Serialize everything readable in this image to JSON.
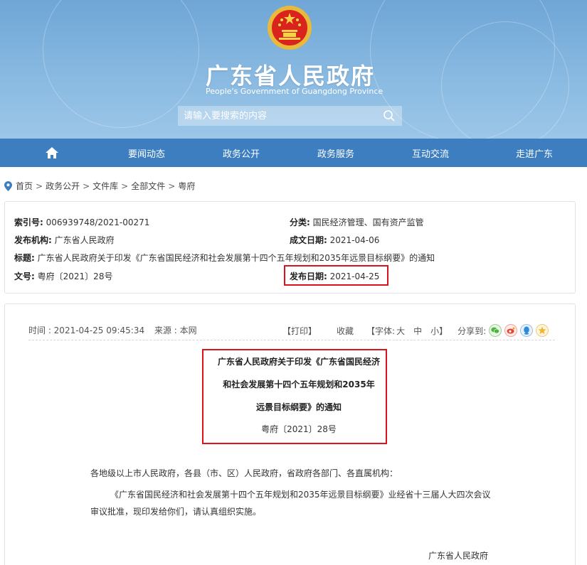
{
  "header": {
    "title": "广东省人民政府",
    "subtitle": "People's Government of Guangdong Province",
    "search_placeholder": "请输入要搜索的内容"
  },
  "nav": {
    "items": [
      "要闻动态",
      "政务公开",
      "政务服务",
      "互动交流",
      "走进广东"
    ]
  },
  "breadcrumb": [
    "首页",
    "政务公开",
    "文件库",
    "全部文件",
    "粤府"
  ],
  "info": {
    "index_label": "索引号:",
    "index_value": "006939748/2021-00271",
    "category_label": "分类:",
    "category_value": "国民经济管理、国有资产监管",
    "issuer_label": "发布机构:",
    "issuer_value": "广东省人民政府",
    "written_label": "成文日期:",
    "written_value": "2021-04-06",
    "title_label": "标题:",
    "title_value": "广东省人民政府关于印发《广东省国民经济和社会发展第十四个五年规划和2035年远景目标纲要》的通知",
    "docno_label": "文号:",
    "docno_value": "粤府〔2021〕28号",
    "pubdate_label": "发布日期:",
    "pubdate_value": "2021-04-25"
  },
  "article": {
    "meta_time": "时间 : 2021-04-25 09:45:34",
    "meta_source": "来源 : 本网",
    "print": "【打印】",
    "favorite": "收藏",
    "font_label": "【字体:",
    "font_large": "大",
    "font_medium": "中",
    "font_small": "小",
    "font_close": "】",
    "share_label": "分享到:",
    "title_line1": "广东省人民政府关于印发《广东省国民经济",
    "title_line2": "和社会发展第十四个五年规划和2035年",
    "title_line3": "远景目标纲要》的通知",
    "doc_no": "粤府〔2021〕28号",
    "salutation": "各地级以上市人民政府，各县（市、区）人民政府，省政府各部门、各直属机构：",
    "para1_line1": "《广东省国民经济和社会发展第十四个五年规划和2035年远景目标纲要》业经省十三届人大四次会议",
    "para1_line2": "审议批准，现印发给你们，请认真组织实施。",
    "signature": "广东省人民政府"
  },
  "colors": {
    "nav_bg": "#3d7ec0",
    "banner": "#7fb2dd",
    "highlight": "#d9141c"
  }
}
